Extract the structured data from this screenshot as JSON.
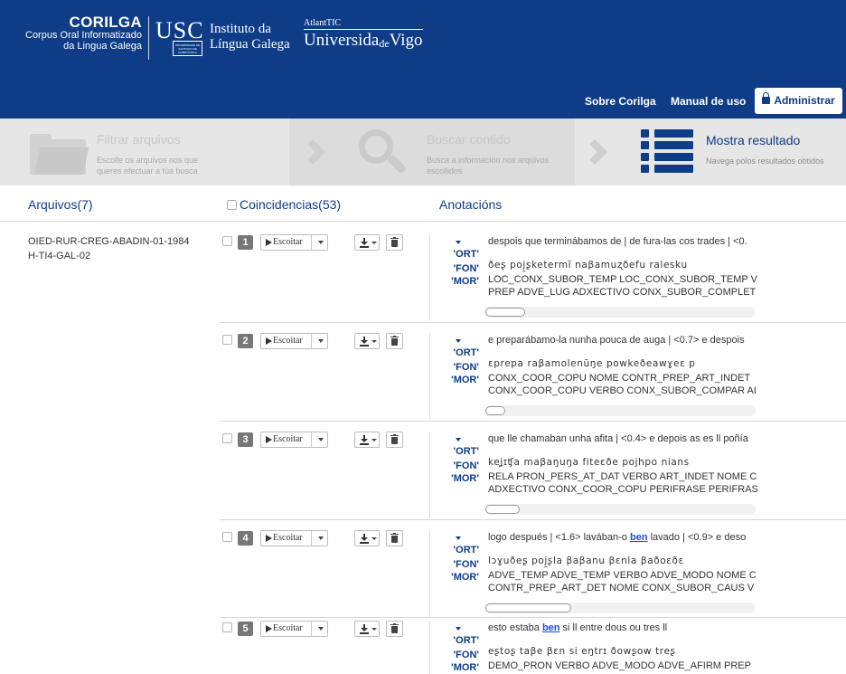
{
  "header": {
    "corilga_title": "CORILGA",
    "corilga_sub1": "Corpus Oral Informatizado",
    "corilga_sub2": "da Lingua Galega",
    "usc_letters": "USC",
    "usc_small": "UNIVERSIDADE DE SANTIAGO DE COMPOSTELA",
    "instituto_line1": "Instituto da",
    "instituto_line2": "Língua Galega",
    "atlantic": "AtlantTIC",
    "vigo_pre": "Universida",
    "vigo_de": "de",
    "vigo_post": "Vigo",
    "nav_sobre": "Sobre Corilga",
    "nav_manual": "Manual de uso",
    "nav_admin": "Administrar"
  },
  "steps": {
    "step1_title": "Filtrar arquivos",
    "step1_desc": "Escolle os arquivos nos que queres efectuar a túa busca",
    "step2_title": "Buscar contido",
    "step2_desc": "Busca a información nos arquivos escollidos",
    "step3_title": "Mostra resultado",
    "step3_desc": "Navega polos resultados obtidos"
  },
  "columns": {
    "arquivos": "Arquivos(7)",
    "coincidencias": "Coincidencias(53)",
    "anotacions": "Anotacións"
  },
  "file_name_line1": "OIED-RUR-CREG-ABADIN-01-1984",
  "file_name_line2": "H-TI4-GAL-02",
  "escoitar_label": "Escoitar",
  "tag_ort": "'ORT'",
  "tag_fon": "'FON'",
  "tag_mor": "'MOR'",
  "results": [
    {
      "num": "1",
      "ort": "despois que terminábamos de | de fura-las cos trades | <0.",
      "ort_hl": "",
      "ort_post": "",
      "fon": "ðeʂ poj̯ʂketermĩ naβamuʐðefu ralesku",
      "mor1": "LOC_CONX_SUBOR_TEMP LOC_CONX_SUBOR_TEMP V",
      "mor2": "PREP ADVE_LUG ADXECTIVO CONX_SUBOR_COMPLET"
    },
    {
      "num": "2",
      "ort": "e preparábamo-la nunha pouca de auga | <0.7> e despois",
      "ort_hl": "",
      "ort_post": "",
      "fon": "ɛprepa raβamolenũŋe powkeðeawɣeɛ p",
      "mor1": "CONX_COOR_COPU NOME CONTR_PREP_ART_INDET",
      "mor2": "CONX_COOR_COPU VERBO CONX_SUBOR_COMPAR AI"
    },
    {
      "num": "3",
      "ort": "que lle chamaban unha afita | <0.4> e depois as es ll poñía",
      "ort_hl": "",
      "ort_post": "",
      "fon": "keʝɪʧa maβaŋuŋa fiteɛðe pojhpo nians",
      "mor1": "RELA PRON_PERS_AT_DAT VERBO ART_INDET NOME C",
      "mor2": "ADXECTIVO CONX_COOR_COPU PERIFRASE PERIFRAS"
    },
    {
      "num": "4",
      "ort": "logo después | <1.6> lavában-o ",
      "ort_hl": "ben",
      "ort_post": " lavado | <0.9> e deso",
      "fon": "lɔɣuðeʂ poj̯ʂla βaβanu βɛnla βaðoɛðɛ",
      "mor1": "ADVE_TEMP ADVE_TEMP VERBO ADVE_MODO NOME C",
      "mor2": "CONTR_PREP_ART_DET NOME CONX_SUBOR_CAUS V"
    },
    {
      "num": "5",
      "ort": "esto estaba ",
      "ort_hl": "ben",
      "ort_post": " si ll entre dous ou tres ll",
      "fon": "eʂtoʂ taβe βɛn si eŋtrɪ ðowʂow treʂ",
      "mor1": "DEMO_PRON VERBO ADVE_MODO ADVE_AFIRM PREP",
      "mor2": ""
    }
  ]
}
